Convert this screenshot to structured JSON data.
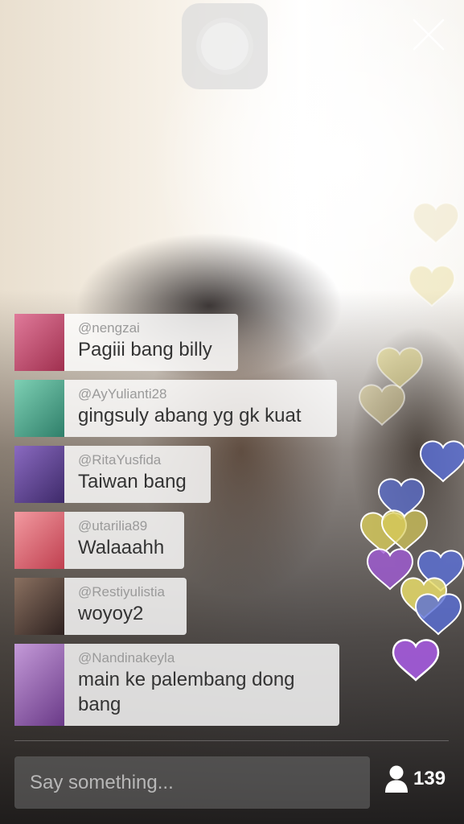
{
  "broadcast": {
    "close_icon": "close-icon",
    "home_icon": "home-button-icon",
    "viewer_icon": "person-icon",
    "viewer_count": "139"
  },
  "comments": [
    {
      "handle": "@nengzai",
      "message": "Pagiii bang billy",
      "avatar_color": "#c4567a"
    },
    {
      "handle": "@AyYulianti28",
      "message": "gingsuly abang yg gk kuat",
      "avatar_color": "#4aa38a"
    },
    {
      "handle": "@RitaYusfida",
      "message": "Taiwan bang",
      "avatar_color": "#6b4b9c"
    },
    {
      "handle": "@utarilia89",
      "message": "Walaaahh",
      "avatar_color": "#e06a72"
    },
    {
      "handle": "@Restiyulistia",
      "message": "woyoy2",
      "avatar_color": "#5a4a44"
    },
    {
      "handle": "@Nandinakeyla",
      "message": "main ke palembang dong bang",
      "avatar_color": "#9b6bb8"
    }
  ],
  "composer": {
    "placeholder": "Say something..."
  },
  "colors": {
    "heart_yellow": "#e8dc6a",
    "heart_blue": "#5a6fd8",
    "heart_purple": "#a05ad6",
    "heart_beige": "#ece0b8"
  }
}
